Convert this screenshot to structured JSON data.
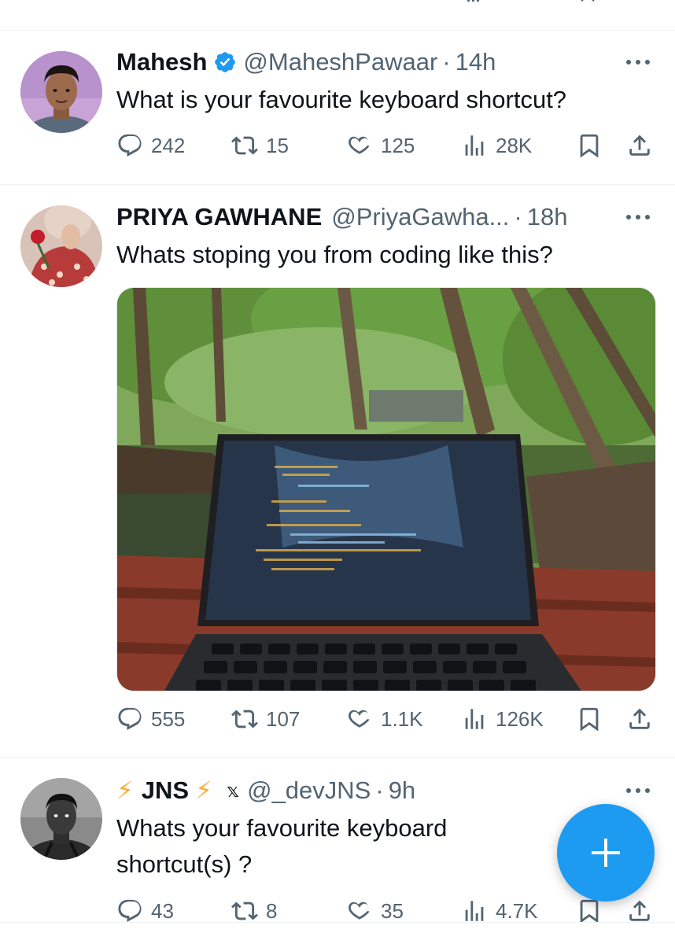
{
  "feed": {
    "tweets": [
      {
        "name": "Mahesh",
        "verified": true,
        "handle": "@MaheshPawaar",
        "time": "14h",
        "text": "What is your favourite keyboard shortcut?",
        "replies": "242",
        "reposts": "15",
        "likes": "125",
        "views": "28K"
      },
      {
        "name": "PRIYA GAWHANE",
        "verified": false,
        "handle": "@PriyaGawha...",
        "time": "18h",
        "text": "Whats stoping you from coding like this?",
        "replies": "555",
        "reposts": "107",
        "likes": "1.1K",
        "views": "126K"
      },
      {
        "name": "JNS",
        "name_decoration": "⚡",
        "handle_prefix": "𝕩",
        "handle": "@_devJNS",
        "time": "9h",
        "text_line1": "Whats your favourite keyboard",
        "text_line2": "shortcut(s) ?",
        "replies": "43",
        "reposts": "8",
        "likes": "35",
        "views": "4.7K"
      }
    ],
    "separator": "·"
  },
  "colors": {
    "accent": "#1d9bf0",
    "text_primary": "#0f1419",
    "text_secondary": "#536471",
    "verified_badge": "#1d9bf0",
    "lightning": "#ffac33"
  },
  "icons": {
    "reply": "reply-icon",
    "repost": "repost-icon",
    "like": "like-icon",
    "views": "views-icon",
    "bookmark": "bookmark-icon",
    "share": "share-icon",
    "more": "more-icon",
    "compose": "compose-plus-icon"
  }
}
